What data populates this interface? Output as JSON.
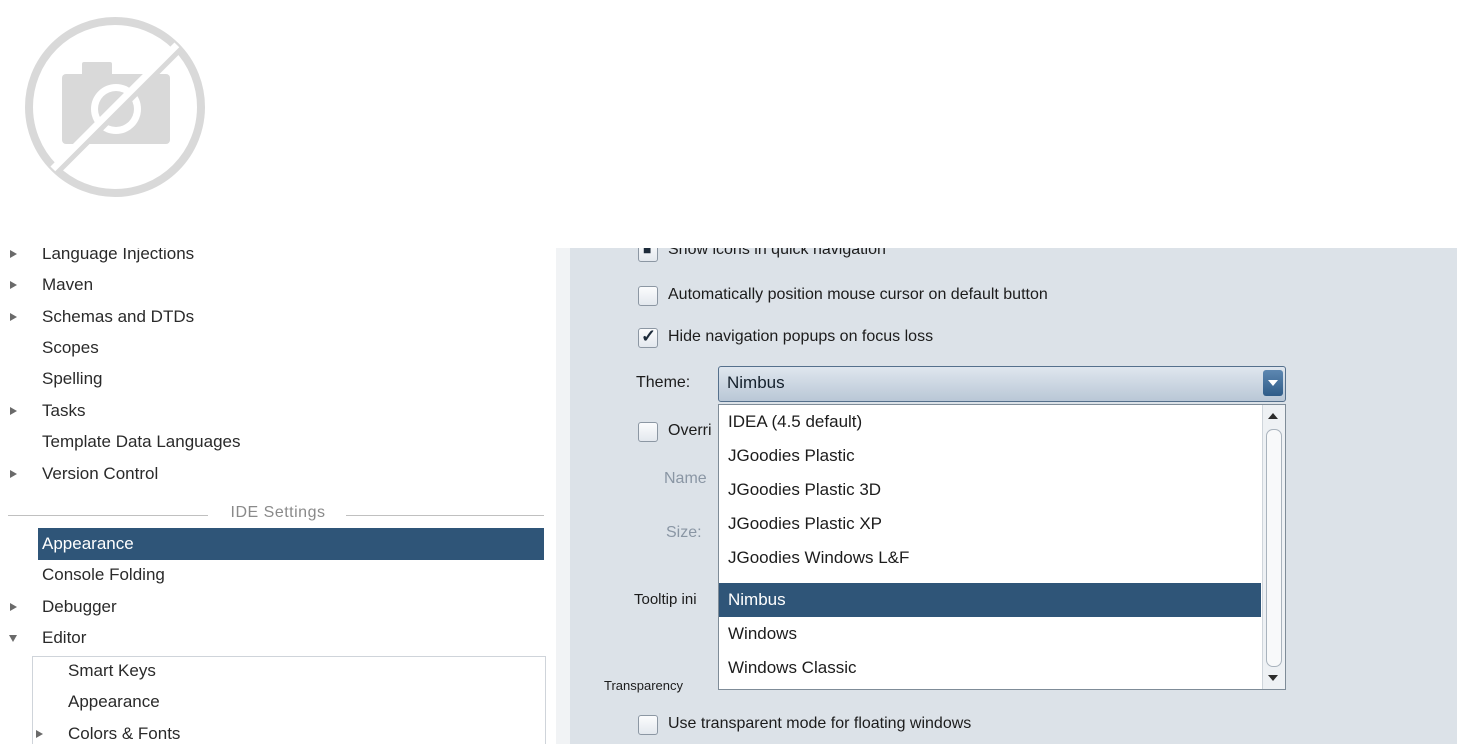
{
  "placeholder_image": {
    "icon": "no-photo-icon"
  },
  "left_tree": {
    "items": [
      {
        "label": "Language Injections",
        "arrow": "right"
      },
      {
        "label": "Maven",
        "arrow": "right"
      },
      {
        "label": "Schemas and DTDs",
        "arrow": "right"
      },
      {
        "label": "Scopes",
        "arrow": "none"
      },
      {
        "label": "Spelling",
        "arrow": "none"
      },
      {
        "label": "Tasks",
        "arrow": "right"
      },
      {
        "label": "Template Data Languages",
        "arrow": "none"
      },
      {
        "label": "Version Control",
        "arrow": "right"
      }
    ],
    "section_label": "IDE Settings",
    "ide_items": [
      {
        "label": "Appearance",
        "arrow": "none",
        "selected": true
      },
      {
        "label": "Console Folding",
        "arrow": "none"
      },
      {
        "label": "Debugger",
        "arrow": "right"
      },
      {
        "label": "Editor",
        "arrow": "down"
      }
    ],
    "editor_children": [
      {
        "label": "Smart Keys",
        "arrow": "none"
      },
      {
        "label": "Appearance",
        "arrow": "none"
      },
      {
        "label": "Colors & Fonts",
        "arrow": "right"
      }
    ]
  },
  "settings": {
    "show_icons_label": "Show icons in quick navigation",
    "auto_position_label": "Automatically position mouse cursor on default button",
    "hide_popups_label": "Hide navigation popups on focus loss",
    "theme_label": "Theme:",
    "theme_value": "Nimbus",
    "override_label": "Overri",
    "name_label": "Name",
    "size_label": "Size:",
    "tooltip_label": "Tooltip ini",
    "transparency_label": "Transparency",
    "transparent_mode_label": "Use transparent mode for floating windows",
    "checked": {
      "show_icons": true,
      "auto_position": false,
      "hide_popups": true,
      "override": false,
      "transparent_mode": false
    }
  },
  "theme_options": [
    "IDEA (4.5 default)",
    "JGoodies Plastic",
    "JGoodies Plastic 3D",
    "JGoodies Plastic XP",
    "JGoodies Windows L&F",
    "Nimbus",
    "Windows",
    "Windows Classic"
  ],
  "selected_theme_index": 5,
  "colors": {
    "selection": "#2f5578",
    "right_panel_bg": "#dce2e8"
  }
}
